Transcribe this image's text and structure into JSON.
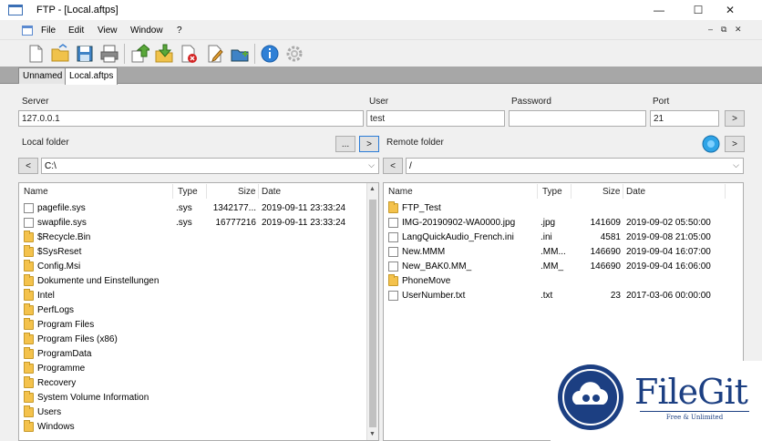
{
  "window": {
    "title": "FTP - [Local.aftps]",
    "minimize": "—",
    "maximize": "☐",
    "close": "✕",
    "mdi_restore": "⧉",
    "mdi_close": "✕",
    "mdi_min": "–"
  },
  "menu": {
    "items": [
      "File",
      "Edit",
      "View",
      "Window",
      "?"
    ]
  },
  "toolbar": {
    "icons": [
      "new-file-icon",
      "open-folder-icon",
      "save-icon",
      "print-icon",
      "upload-icon",
      "download-icon",
      "delete-icon",
      "edit-icon",
      "new-folder-icon",
      "info-icon",
      "settings-icon"
    ]
  },
  "tabs": [
    "Unnamed",
    "Local.aftps"
  ],
  "connection": {
    "server_label": "Server",
    "server_value": "127.0.0.1",
    "user_label": "User",
    "user_value": "test",
    "password_label": "Password",
    "password_value": "",
    "port_label": "Port",
    "port_value": "21",
    "connect_button": ">"
  },
  "local": {
    "label": "Local folder",
    "browse_button": "...",
    "go_button": ">",
    "up_button": "<",
    "path": "C:\\",
    "columns": {
      "name": "Name",
      "type": "Type",
      "size": "Size",
      "date": "Date"
    },
    "rows": [
      {
        "name": "pagefile.sys",
        "type": ".sys",
        "size": "1342177...",
        "date": "2019-09-11 23:33:24",
        "kind": "file"
      },
      {
        "name": "swapfile.sys",
        "type": ".sys",
        "size": "16777216",
        "date": "2019-09-11 23:33:24",
        "kind": "file"
      },
      {
        "name": "$Recycle.Bin",
        "type": "",
        "size": "",
        "date": "",
        "kind": "folder"
      },
      {
        "name": "$SysReset",
        "type": "",
        "size": "",
        "date": "",
        "kind": "folder"
      },
      {
        "name": "Config.Msi",
        "type": "",
        "size": "",
        "date": "",
        "kind": "folder"
      },
      {
        "name": "Dokumente und Einstellungen",
        "type": "",
        "size": "",
        "date": "",
        "kind": "folder"
      },
      {
        "name": "Intel",
        "type": "",
        "size": "",
        "date": "",
        "kind": "folder"
      },
      {
        "name": "PerfLogs",
        "type": "",
        "size": "",
        "date": "",
        "kind": "folder"
      },
      {
        "name": "Program Files",
        "type": "",
        "size": "",
        "date": "",
        "kind": "folder"
      },
      {
        "name": "Program Files (x86)",
        "type": "",
        "size": "",
        "date": "",
        "kind": "folder"
      },
      {
        "name": "ProgramData",
        "type": "",
        "size": "",
        "date": "",
        "kind": "folder"
      },
      {
        "name": "Programme",
        "type": "",
        "size": "",
        "date": "",
        "kind": "folder"
      },
      {
        "name": "Recovery",
        "type": "",
        "size": "",
        "date": "",
        "kind": "folder"
      },
      {
        "name": "System Volume Information",
        "type": "",
        "size": "",
        "date": "",
        "kind": "folder"
      },
      {
        "name": "Users",
        "type": "",
        "size": "",
        "date": "",
        "kind": "folder"
      },
      {
        "name": "Windows",
        "type": "",
        "size": "",
        "date": "",
        "kind": "folder"
      }
    ]
  },
  "remote": {
    "label": "Remote folder",
    "go_button": ">",
    "up_button": "<",
    "path": "/",
    "columns": {
      "name": "Name",
      "type": "Type",
      "size": "Size",
      "date": "Date"
    },
    "rows": [
      {
        "name": "FTP_Test",
        "type": "",
        "size": "",
        "date": "",
        "kind": "folder"
      },
      {
        "name": "IMG-20190902-WA0000.jpg",
        "type": ".jpg",
        "size": "141609",
        "date": "2019-09-02 05:50:00",
        "kind": "file"
      },
      {
        "name": "LangQuickAudio_French.ini",
        "type": ".ini",
        "size": "4581",
        "date": "2019-09-08 21:05:00",
        "kind": "file"
      },
      {
        "name": "New.MMM",
        "type": ".MM...",
        "size": "146690",
        "date": "2019-09-04 16:07:00",
        "kind": "file"
      },
      {
        "name": "New_BAK0.MM_",
        "type": ".MM_",
        "size": "146690",
        "date": "2019-09-04 16:06:00",
        "kind": "file"
      },
      {
        "name": "PhoneMove",
        "type": "",
        "size": "",
        "date": "",
        "kind": "folder"
      },
      {
        "name": "UserNumber.txt",
        "type": ".txt",
        "size": "23",
        "date": "2017-03-06 00:00:00",
        "kind": "file"
      }
    ]
  },
  "watermark": {
    "name": "FileGit",
    "tagline": "Free & Unlimited"
  }
}
